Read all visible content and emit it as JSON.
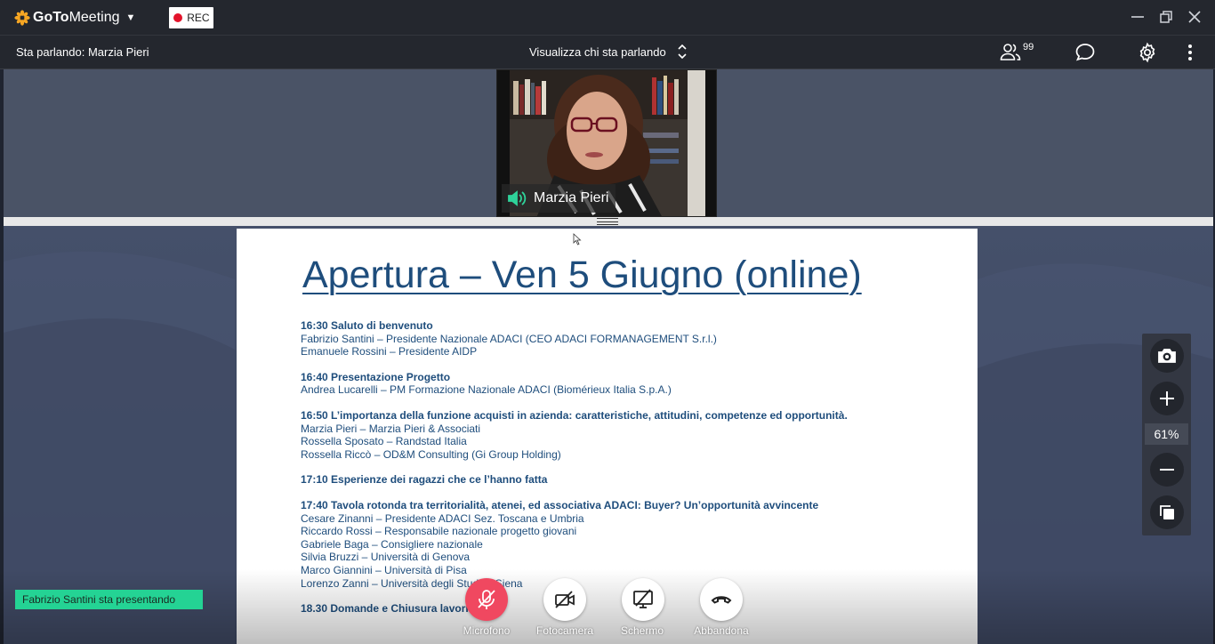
{
  "app": {
    "brand_bold": "GoTo",
    "brand_rest": "Meeting",
    "rec_label": "REC"
  },
  "toolbar": {
    "speaking": "Sta parlando: Marzia Pieri",
    "view_selector": "Visualizza chi sta parlando",
    "participants_count": "99"
  },
  "video": {
    "speaker_name": "Marzia Pieri"
  },
  "slide": {
    "title": "Apertura – Ven 5 Giugno (online)",
    "agenda": [
      {
        "head": "16:30 Saluto di benvenuto",
        "lines": [
          "Fabrizio Santini – Presidente Nazionale ADACI (CEO ADACI FORMANAGEMENT S.r.l.)",
          "Emanuele Rossini – Presidente AIDP"
        ]
      },
      {
        "head": "16:40 Presentazione Progetto",
        "lines": [
          "Andrea Lucarelli – PM Formazione Nazionale ADACI (Biomérieux Italia S.p.A.)"
        ]
      },
      {
        "head": "16:50   L’importanza della funzione acquisti in azienda: caratteristiche, attitudini, competenze ed opportunità.",
        "lines": [
          "Marzia Pieri – Marzia Pieri & Associati",
          "Rossella Sposato – Randstad Italia",
          "Rossella Riccò – OD&M Consulting (Gi Group Holding)"
        ]
      },
      {
        "head": "17:10   Esperienze dei ragazzi che ce l’hanno fatta",
        "lines": []
      },
      {
        "head": "17:40 Tavola rotonda tra territorialità, atenei, ed associativa ADACI: Buyer? Un’opportunità avvincente",
        "lines": [
          "Cesare Zinanni – Presidente ADACI Sez. Toscana e Umbria",
          "Riccardo Rossi – Responsabile nazionale progetto giovani",
          "Gabriele Baga – Consigliere nazionale",
          "Silvia Bruzzi – Università di Genova",
          "Marco Giannini – Università di Pisa",
          "Lorenzo Zanni – Università degli Studi di Siena"
        ]
      },
      {
        "head": "18.30   Domande e Chiusura lavori",
        "lines": []
      }
    ]
  },
  "zoom": {
    "level": "61%"
  },
  "presenter_banner": "Fabrizio Santini sta presentando",
  "controls": {
    "mic": "Microfono",
    "camera": "Fotocamera",
    "screen": "Schermo",
    "leave": "Abbandona"
  },
  "colors": {
    "accent_green": "#24d394",
    "mic_red": "#f04860",
    "slide_text": "#1e4d7c"
  }
}
